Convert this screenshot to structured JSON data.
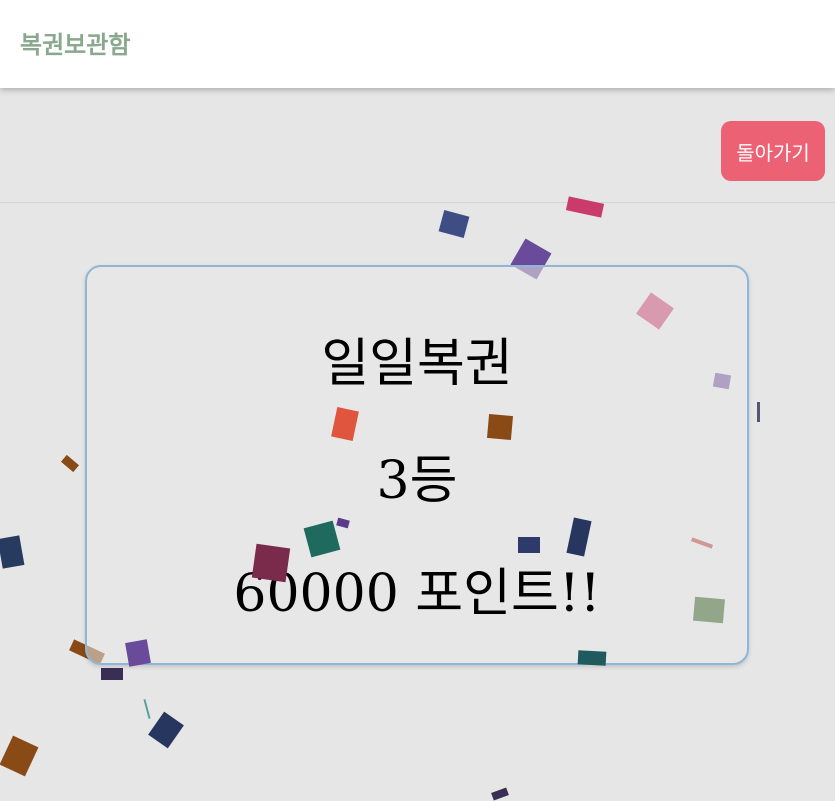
{
  "header": {
    "title": "복권보관함"
  },
  "toolbar": {
    "back_label": "돌아가기"
  },
  "result": {
    "lottery_name": "일일복권",
    "rank": "3등",
    "prize": "60000 포인트!!"
  },
  "colors": {
    "header_title": "#8aa88e",
    "back_button": "#ec6173",
    "card_border": "#8fb6d8",
    "background": "#e6e6e6"
  },
  "decorations": {
    "icon": "confetti-icon"
  }
}
